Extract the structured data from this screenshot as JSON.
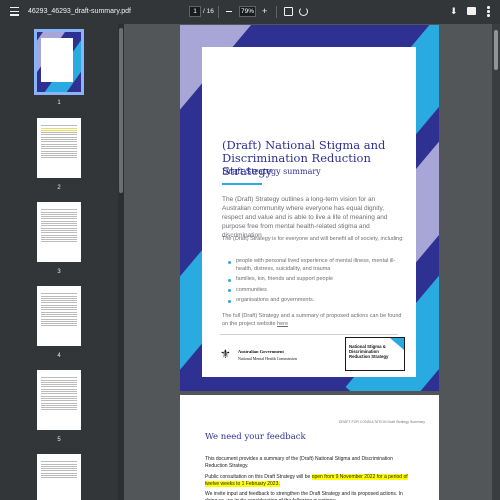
{
  "toolbar": {
    "file_name": "46293_46293_draft-summary.pdf",
    "current_page": "1",
    "page_total": "/ 16",
    "zoom_value": "79%",
    "zoom_minus": "–",
    "zoom_plus": "+",
    "download_icon": "download-icon",
    "print_icon": "print-icon",
    "more_icon": "more-vert-icon"
  },
  "sidebar": {
    "thumbnails": [
      {
        "num": "1"
      },
      {
        "num": "2"
      },
      {
        "num": "3"
      },
      {
        "num": "4"
      },
      {
        "num": "5"
      }
    ]
  },
  "page1": {
    "title": "(Draft) National Stigma and Discrimination Reduction Strategy",
    "subtitle": "Draft Strategy summary",
    "intro": "The (Draft) Strategy outlines a long-term vision for an Australian community where everyone has equal dignity, respect and value and is able to live a life of meaning and purpose free from mental health-related stigma and discrimination",
    "para2": "The (Draft) Strategy is for everyone and will benefit all of society, including:",
    "bullets": [
      "people with personal lived experience of mental illness, mental ill-health, distress, suicidality, and trauma",
      "families, kin, friends and support people",
      "communities",
      "organisations and governments."
    ],
    "para3": "The full (Draft) Strategy and a summary of proposed actions can be found on the project website ",
    "link_text": "here",
    "gov_line1": "Australian Government",
    "gov_line2": "National Mental Health Commission",
    "nsd_logo_text": "National Stigma & Discrimination Reduction Strategy",
    "colors": {
      "navy": "#2e3192",
      "cyan": "#29abe2",
      "lavender": "#a8a6d6"
    }
  },
  "page2": {
    "header": "DRAFT FOR CONSULTATION Draft Strategy Summary",
    "title": "We need your feedback",
    "para1": "This document provides a summary of the (Draft) National Stigma and Discrimination Reduction Strategy.",
    "para2_a": "Public consultation on this Draft Strategy will be ",
    "para2_hl": "open from 9 November 2022 for a period of twelve weeks to 1 February 2023.",
    "para3": "We invite input and feedback to strengthen the Draft Strategy and its proposed actions. In doing so, we invite consideration of the following questions:"
  }
}
